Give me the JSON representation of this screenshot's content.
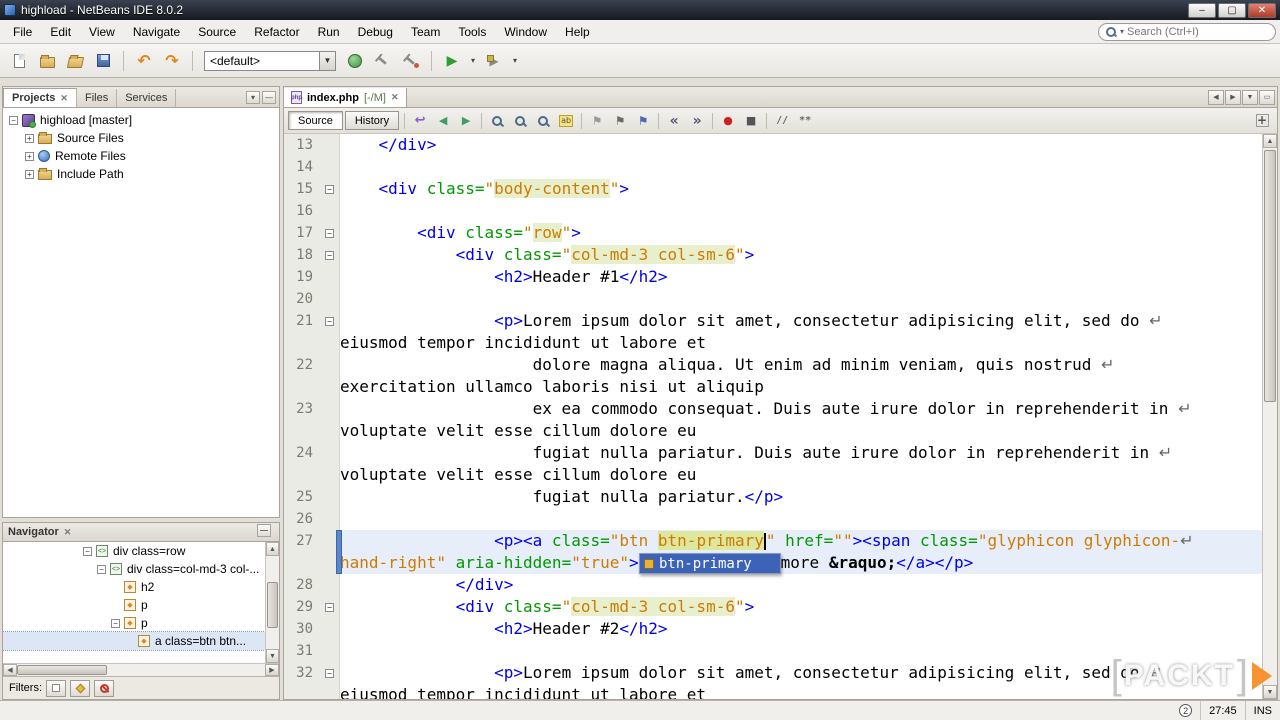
{
  "window": {
    "title": "highload - NetBeans IDE 8.0.2"
  },
  "window_controls": {
    "minimize": "–",
    "maximize": "▢",
    "close": "✕"
  },
  "menubar": {
    "items": [
      "File",
      "Edit",
      "View",
      "Navigate",
      "Source",
      "Refactor",
      "Run",
      "Debug",
      "Team",
      "Tools",
      "Window",
      "Help"
    ],
    "search_placeholder": "Search (Ctrl+I)"
  },
  "toolbar": {
    "config": "<default>",
    "buttons": [
      "new-file",
      "new-project",
      "open-project",
      "save-all",
      "sep",
      "undo",
      "redo",
      "sep",
      "combo",
      "deploy",
      "build",
      "clean-build",
      "sep",
      "run",
      "run-menu",
      "debug",
      "debug-menu"
    ]
  },
  "projects_panel": {
    "tabs": [
      "Projects",
      "Files",
      "Services"
    ],
    "tree": [
      {
        "label": "highload [master]",
        "indent": 0,
        "expander": "minus",
        "icon": "project"
      },
      {
        "label": "Source Files",
        "indent": 1,
        "expander": "plus",
        "icon": "folder"
      },
      {
        "label": "Remote Files",
        "indent": 1,
        "expander": "plus",
        "icon": "remote"
      },
      {
        "label": "Include Path",
        "indent": 1,
        "expander": "plus",
        "icon": "folder"
      }
    ]
  },
  "navigator": {
    "title": "Navigator",
    "rows": [
      {
        "label": "div class=row",
        "indent": 0,
        "expander": "minus",
        "icon": "div"
      },
      {
        "label": "div class=col-md-3 col-...",
        "indent": 1,
        "expander": "minus",
        "icon": "div"
      },
      {
        "label": "h2",
        "indent": 2,
        "expander": "none",
        "icon": "tag"
      },
      {
        "label": "p",
        "indent": 2,
        "expander": "none",
        "icon": "tag"
      },
      {
        "label": "p",
        "indent": 2,
        "expander": "minus",
        "icon": "tag"
      },
      {
        "label": "a class=btn btn...",
        "indent": 3,
        "expander": "none",
        "icon": "tag",
        "selected": true
      }
    ],
    "filters_label": "Filters:"
  },
  "editor": {
    "tab": {
      "name": "index.php",
      "suffix": "[-/M]"
    },
    "view_buttons": [
      "Source",
      "History"
    ],
    "toolbar_icons": [
      "last-edit",
      "back",
      "forward",
      "sep",
      "find-selection",
      "find-next",
      "find-previous",
      "highlight-search",
      "sep",
      "previous-bookmark",
      "next-bookmark",
      "toggle-bookmark",
      "sep",
      "shift-left",
      "shift-right",
      "sep",
      "start-macro",
      "stop-macro",
      "sep",
      "comment",
      "uncomment"
    ],
    "completion": {
      "selected": "btn-primary"
    }
  },
  "status": {
    "notifications": "2",
    "caret": "27:45",
    "mode": "INS"
  },
  "watermark": {
    "text": "PACKT"
  },
  "code": {
    "lines": [
      {
        "num": "13",
        "rows": [
          [
            {
              "c": "pl",
              "s": "    "
            },
            {
              "c": "tag",
              "s": "</div>"
            }
          ]
        ]
      },
      {
        "num": "14",
        "rows": [
          []
        ]
      },
      {
        "num": "15",
        "fold": true,
        "rows": [
          [
            {
              "c": "pl",
              "s": "    "
            },
            {
              "c": "tag",
              "s": "<div"
            },
            {
              "c": "attr",
              "s": " class="
            },
            {
              "c": "val",
              "s": "\""
            },
            {
              "c": "vhl",
              "s": "body-content"
            },
            {
              "c": "val",
              "s": "\""
            },
            {
              "c": "tag",
              "s": ">"
            }
          ]
        ]
      },
      {
        "num": "16",
        "rows": [
          []
        ]
      },
      {
        "num": "17",
        "fold": true,
        "rows": [
          [
            {
              "c": "pl",
              "s": "        "
            },
            {
              "c": "tag",
              "s": "<div"
            },
            {
              "c": "attr",
              "s": " class="
            },
            {
              "c": "val",
              "s": "\""
            },
            {
              "c": "vhl",
              "s": "row"
            },
            {
              "c": "val",
              "s": "\""
            },
            {
              "c": "tag",
              "s": ">"
            }
          ]
        ]
      },
      {
        "num": "18",
        "fold": true,
        "rows": [
          [
            {
              "c": "pl",
              "s": "            "
            },
            {
              "c": "tag",
              "s": "<div"
            },
            {
              "c": "attr",
              "s": " class="
            },
            {
              "c": "val",
              "s": "\""
            },
            {
              "c": "vhl",
              "s": "col-md-3 col-sm-6"
            },
            {
              "c": "val",
              "s": "\""
            },
            {
              "c": "tag",
              "s": ">"
            }
          ]
        ]
      },
      {
        "num": "19",
        "rows": [
          [
            {
              "c": "pl",
              "s": "                "
            },
            {
              "c": "tag",
              "s": "<h2>"
            },
            {
              "c": "pl",
              "s": "Header #1"
            },
            {
              "c": "tag",
              "s": "</h2>"
            }
          ]
        ]
      },
      {
        "num": "20",
        "rows": [
          []
        ]
      },
      {
        "num": "21",
        "fold": true,
        "rows": [
          [
            {
              "c": "pl",
              "s": "                "
            },
            {
              "c": "tag",
              "s": "<p>"
            },
            {
              "c": "pl",
              "s": "Lorem ipsum dolor sit amet, consectetur adipisicing elit, sed do "
            },
            {
              "c": "wrap",
              "s": "↵"
            }
          ],
          [
            {
              "c": "pl",
              "s": "eiusmod tempor incididunt ut labore et"
            }
          ]
        ]
      },
      {
        "num": "22",
        "rows": [
          [
            {
              "c": "pl",
              "s": "                    dolore magna aliqua. Ut enim ad minim veniam, quis nostrud "
            },
            {
              "c": "wrap",
              "s": "↵"
            }
          ],
          [
            {
              "c": "pl",
              "s": "exercitation ullamco laboris nisi ut aliquip"
            }
          ]
        ]
      },
      {
        "num": "23",
        "rows": [
          [
            {
              "c": "pl",
              "s": "                    ex ea commodo consequat. Duis aute irure dolor in reprehenderit in "
            },
            {
              "c": "wrap",
              "s": "↵"
            }
          ],
          [
            {
              "c": "pl",
              "s": "voluptate velit esse cillum dolore eu"
            }
          ]
        ]
      },
      {
        "num": "24",
        "rows": [
          [
            {
              "c": "pl",
              "s": "                    fugiat nulla pariatur. Duis aute irure dolor in reprehenderit in "
            },
            {
              "c": "wrap",
              "s": "↵"
            }
          ],
          [
            {
              "c": "pl",
              "s": "voluptate velit esse cillum dolore eu"
            }
          ]
        ]
      },
      {
        "num": "25",
        "rows": [
          [
            {
              "c": "pl",
              "s": "                    fugiat nulla pariatur."
            },
            {
              "c": "tag",
              "s": "</p>"
            }
          ]
        ]
      },
      {
        "num": "26",
        "rows": [
          []
        ]
      },
      {
        "num": "27",
        "current": true,
        "rows": [
          [
            {
              "c": "pl",
              "s": "                "
            },
            {
              "c": "tag",
              "s": "<p><a"
            },
            {
              "c": "attr",
              "s": " class="
            },
            {
              "c": "val",
              "s": "\"btn "
            },
            {
              "c": "vhl2",
              "s": "btn-primary"
            },
            {
              "c": "caret",
              "s": ""
            },
            {
              "c": "val",
              "s": "\""
            },
            {
              "c": "attr",
              "s": " href="
            },
            {
              "c": "val",
              "s": "\"\""
            },
            {
              "c": "tag",
              "s": "><span"
            },
            {
              "c": "attr",
              "s": " class="
            },
            {
              "c": "val",
              "s": "\"glyphicon glyphicon-"
            },
            {
              "c": "wrap",
              "s": "↵"
            }
          ],
          [
            {
              "c": "val",
              "s": "hand-right\""
            },
            {
              "c": "attr",
              "s": " aria-hidden="
            },
            {
              "c": "val",
              "s": "\"true\""
            },
            {
              "c": "tag",
              "s": ">"
            },
            {
              "c": "gap",
              "s": ""
            },
            {
              "c": "pl",
              "s": "more "
            },
            {
              "c": "ent",
              "s": "&raquo;"
            },
            {
              "c": "tag",
              "s": "</a></p>"
            }
          ]
        ]
      },
      {
        "num": "28",
        "rows": [
          [
            {
              "c": "pl",
              "s": "            "
            },
            {
              "c": "tag",
              "s": "</div>"
            }
          ]
        ]
      },
      {
        "num": "29",
        "fold": true,
        "rows": [
          [
            {
              "c": "pl",
              "s": "            "
            },
            {
              "c": "tag",
              "s": "<div"
            },
            {
              "c": "attr",
              "s": " class="
            },
            {
              "c": "val",
              "s": "\""
            },
            {
              "c": "vhl",
              "s": "col-md-3 col-sm-6"
            },
            {
              "c": "val",
              "s": "\""
            },
            {
              "c": "tag",
              "s": ">"
            }
          ]
        ]
      },
      {
        "num": "30",
        "rows": [
          [
            {
              "c": "pl",
              "s": "                "
            },
            {
              "c": "tag",
              "s": "<h2>"
            },
            {
              "c": "pl",
              "s": "Header #2"
            },
            {
              "c": "tag",
              "s": "</h2>"
            }
          ]
        ]
      },
      {
        "num": "31",
        "rows": [
          []
        ]
      },
      {
        "num": "32",
        "fold": true,
        "rows": [
          [
            {
              "c": "pl",
              "s": "                "
            },
            {
              "c": "tag",
              "s": "<p>"
            },
            {
              "c": "pl",
              "s": "Lorem ipsum dolor sit amet, consectetur adipisicing elit, sed do "
            },
            {
              "c": "wrap",
              "s": "↵"
            }
          ],
          [
            {
              "c": "pl",
              "s": "eiusmod tempor incididunt ut labore et"
            }
          ]
        ]
      }
    ]
  }
}
